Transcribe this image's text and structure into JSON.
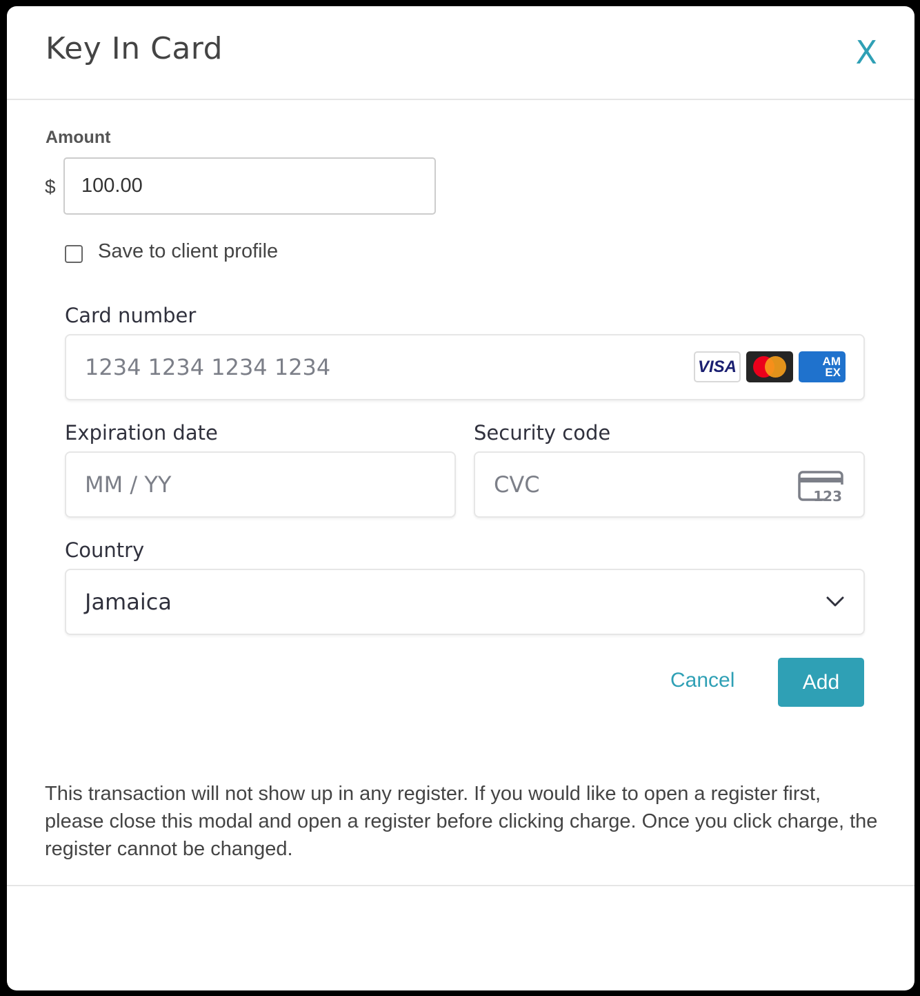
{
  "modal": {
    "title": "Key In Card",
    "close_label": "X"
  },
  "amount": {
    "label": "Amount",
    "currency_symbol": "$",
    "value": "100.00"
  },
  "save_profile": {
    "label": "Save to client profile",
    "checked": false
  },
  "card_number": {
    "label": "Card number",
    "placeholder": "1234 1234 1234 1234",
    "brands": {
      "visa": "VISA",
      "amex_line1": "AM",
      "amex_line2": "EX"
    }
  },
  "expiration": {
    "label": "Expiration date",
    "placeholder": "MM / YY"
  },
  "security_code": {
    "label": "Security code",
    "placeholder": "CVC",
    "icon_text": "123"
  },
  "country": {
    "label": "Country",
    "value": "Jamaica"
  },
  "actions": {
    "cancel_label": "Cancel",
    "add_label": "Add"
  },
  "notice": "This transaction will not show up in any register. If you would like to open a register first, please close this modal and open a register before clicking charge. Once you click charge, the register cannot be changed.",
  "colors": {
    "accent": "#2fa0b5",
    "text": "#444444",
    "field_text": "#30313d",
    "placeholder": "#7c7f88"
  }
}
